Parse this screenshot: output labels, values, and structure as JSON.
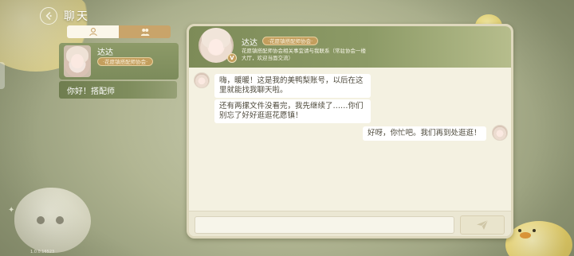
{
  "header": {
    "title": "聊天"
  },
  "contacts": [
    {
      "name": "达达",
      "badge": "花愿镇搭配师协会",
      "preview": "你好！搭配师"
    }
  ],
  "chat": {
    "contact_name": "达达",
    "contact_badge": "花愿镇搭配师协会",
    "contact_desc": "花愿镇搭配师协会相关事宜请与我联系（常驻协会一楼大厅，欢迎当面交流）",
    "messages": [
      {
        "from": "contact",
        "text": "嗨，暖暖！这是我的美鸭梨账号，以后在这里就能找我聊天啦。"
      },
      {
        "from": "contact",
        "text": "还有两摞文件没看完，我先继续了……你们别忘了好好逛逛花愿镇！"
      },
      {
        "from": "player",
        "text": "好呀，你忙吧。我们再到处逛逛！"
      }
    ],
    "input_value": ""
  },
  "icons": {
    "back": "back-arrow-icon",
    "tab_single": "single-person-icon",
    "tab_group": "group-icon",
    "send": "paper-plane-icon",
    "verified": "verified-v-icon"
  },
  "colors": {
    "header_green": "#7d8b58",
    "badge_gold": "#c39e5d",
    "panel_cream": "#f4f1e1"
  },
  "version_text": "1.0.0.16523"
}
